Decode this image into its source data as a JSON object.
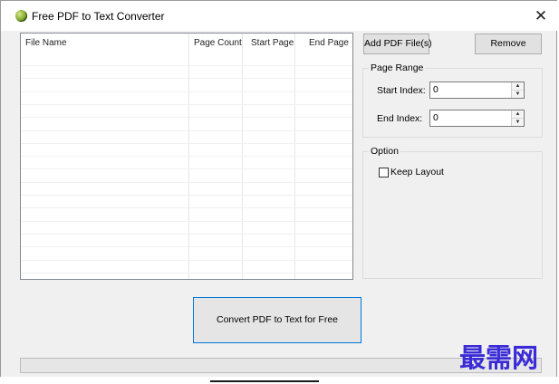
{
  "window": {
    "title": "Free PDF to Text Converter",
    "close_glyph": "✕",
    "icon": "app-globe-icon"
  },
  "file_list": {
    "columns": [
      "File Name",
      "Page Count",
      "Start Page",
      "End Page"
    ],
    "rows": []
  },
  "buttons": {
    "add": "Add PDF File(s)",
    "remove": "Remove",
    "convert": "Convert PDF to Text for Free"
  },
  "page_range": {
    "title": "Page Range",
    "start_label": "Start Index:",
    "start_value": "0",
    "end_label": "End Index:",
    "end_value": "0"
  },
  "option": {
    "title": "Option",
    "keep_layout_label": "Keep Layout",
    "keep_layout_checked": false
  },
  "progress": {
    "value": 0
  },
  "watermark": {
    "text": "最需网"
  },
  "colors": {
    "focus_border": "#0078d7",
    "watermark": "#3a2bd6"
  }
}
